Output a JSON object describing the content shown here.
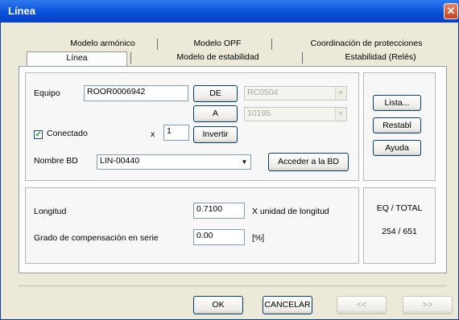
{
  "window": {
    "title": "Línea",
    "close_glyph": "✕"
  },
  "tabs_row1": [
    "Modelo armónico",
    "Modelo OPF",
    "Coordinación de protecciones"
  ],
  "tabs_row2": [
    "Línea",
    "Modelo de estabilidad",
    "Estabilidad (Relés)"
  ],
  "equipo": {
    "label": "Equipo",
    "value": "ROOR0006942",
    "de_button": "DE",
    "a_button": "A",
    "de_value": "RC0504",
    "a_value": "10195",
    "conectado_label": "Conectado",
    "conectado_checked": true,
    "x_label": "x",
    "x_value": "1",
    "invertir_button": "Invertir",
    "nombre_bd_label": "Nombre BD",
    "nombre_bd_value": "LIN-00440",
    "acceder_button": "Acceder a la BD"
  },
  "side": {
    "lista": "Lista...",
    "restabl": "Restabl",
    "ayuda": "Ayuda"
  },
  "longitud": {
    "label": "Longitud",
    "value": "0.7100",
    "unit": "X unidad de longitud",
    "grado_label": "Grado de compensación en serie",
    "grado_value": "0.00",
    "grado_unit": "[%]"
  },
  "eq": {
    "label": "EQ / TOTAL",
    "value": "254 / 651"
  },
  "bottom": {
    "ok": "OK",
    "cancel": "CANCELAR",
    "prev": "<<",
    "next": ">>"
  }
}
